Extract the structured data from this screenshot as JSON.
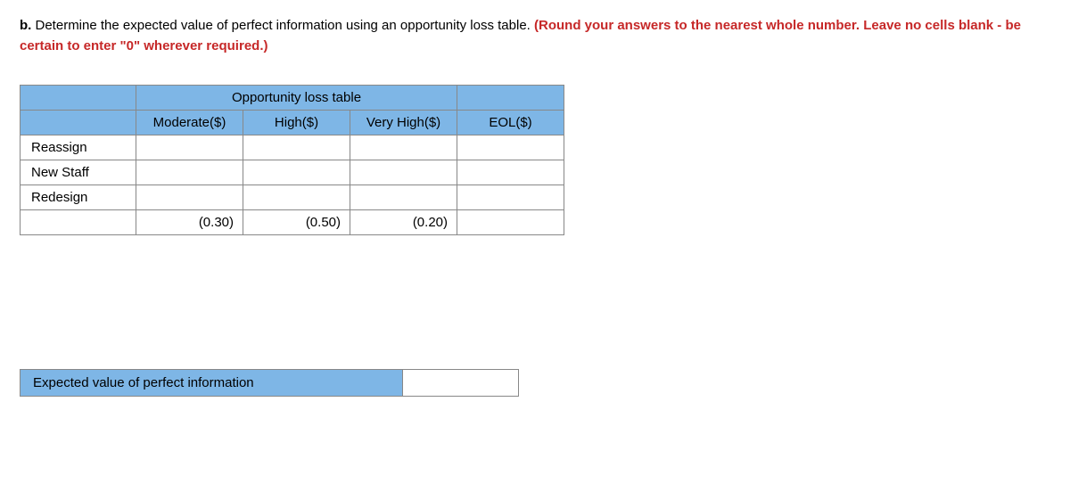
{
  "question": {
    "prefix": "b.",
    "text": " Determine the expected value of perfect information using an opportunity loss table. ",
    "instruction": "(Round your answers to the nearest whole number. Leave no cells blank - be certain to enter \"0\" wherever required.)"
  },
  "table": {
    "title": "Opportunity loss table",
    "columns": [
      "Moderate($)",
      "High($)",
      "Very High($)",
      "EOL($)"
    ],
    "rows": [
      "Reassign",
      "New Staff",
      "Redesign"
    ],
    "probabilities": [
      "(0.30)",
      "(0.50)",
      "(0.20)"
    ]
  },
  "evpi": {
    "label": "Expected value of perfect information"
  },
  "chart_data": {
    "type": "table",
    "title": "Opportunity loss table",
    "columns": [
      "",
      "Moderate($)",
      "High($)",
      "Very High($)",
      "EOL($)"
    ],
    "rows": [
      {
        "label": "Reassign",
        "values": [
          "",
          "",
          "",
          ""
        ]
      },
      {
        "label": "New Staff",
        "values": [
          "",
          "",
          "",
          ""
        ]
      },
      {
        "label": "Redesign",
        "values": [
          "",
          "",
          "",
          ""
        ]
      },
      {
        "label": "",
        "values": [
          "(0.30)",
          "(0.50)",
          "(0.20)",
          ""
        ]
      }
    ]
  }
}
